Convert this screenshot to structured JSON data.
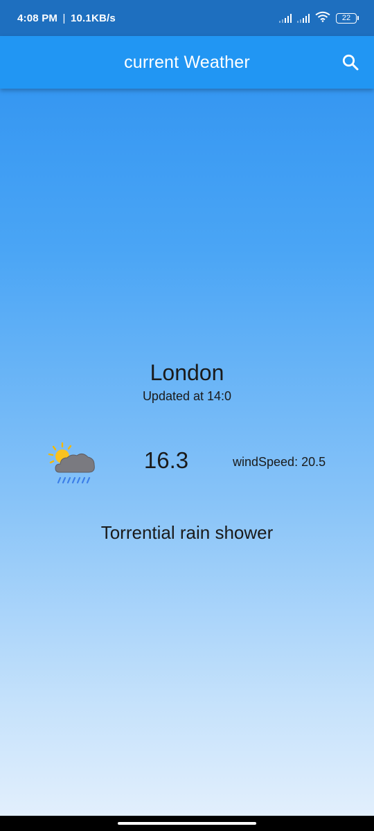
{
  "status_bar": {
    "time": "4:08 PM",
    "separator": "|",
    "network_speed": "10.1KB/s",
    "battery": "22",
    "icons": [
      "signal-icon",
      "signal-icon",
      "wifi-icon",
      "battery-icon"
    ]
  },
  "app_bar": {
    "title": "current Weather",
    "search_icon": "search-icon",
    "color": "#2196f3"
  },
  "weather": {
    "city": "London",
    "updated": "Updated at 14:0",
    "temperature": "16.3",
    "wind": "windSpeed: 20.5",
    "condition": "Torrential rain shower",
    "icon": "sun-cloud-rain-icon"
  },
  "colors": {
    "status_bar": "#1e6fbf",
    "gradient_top": "#2a8ff0",
    "gradient_bottom": "#e6f1fd",
    "text": "#1a1a1a"
  }
}
